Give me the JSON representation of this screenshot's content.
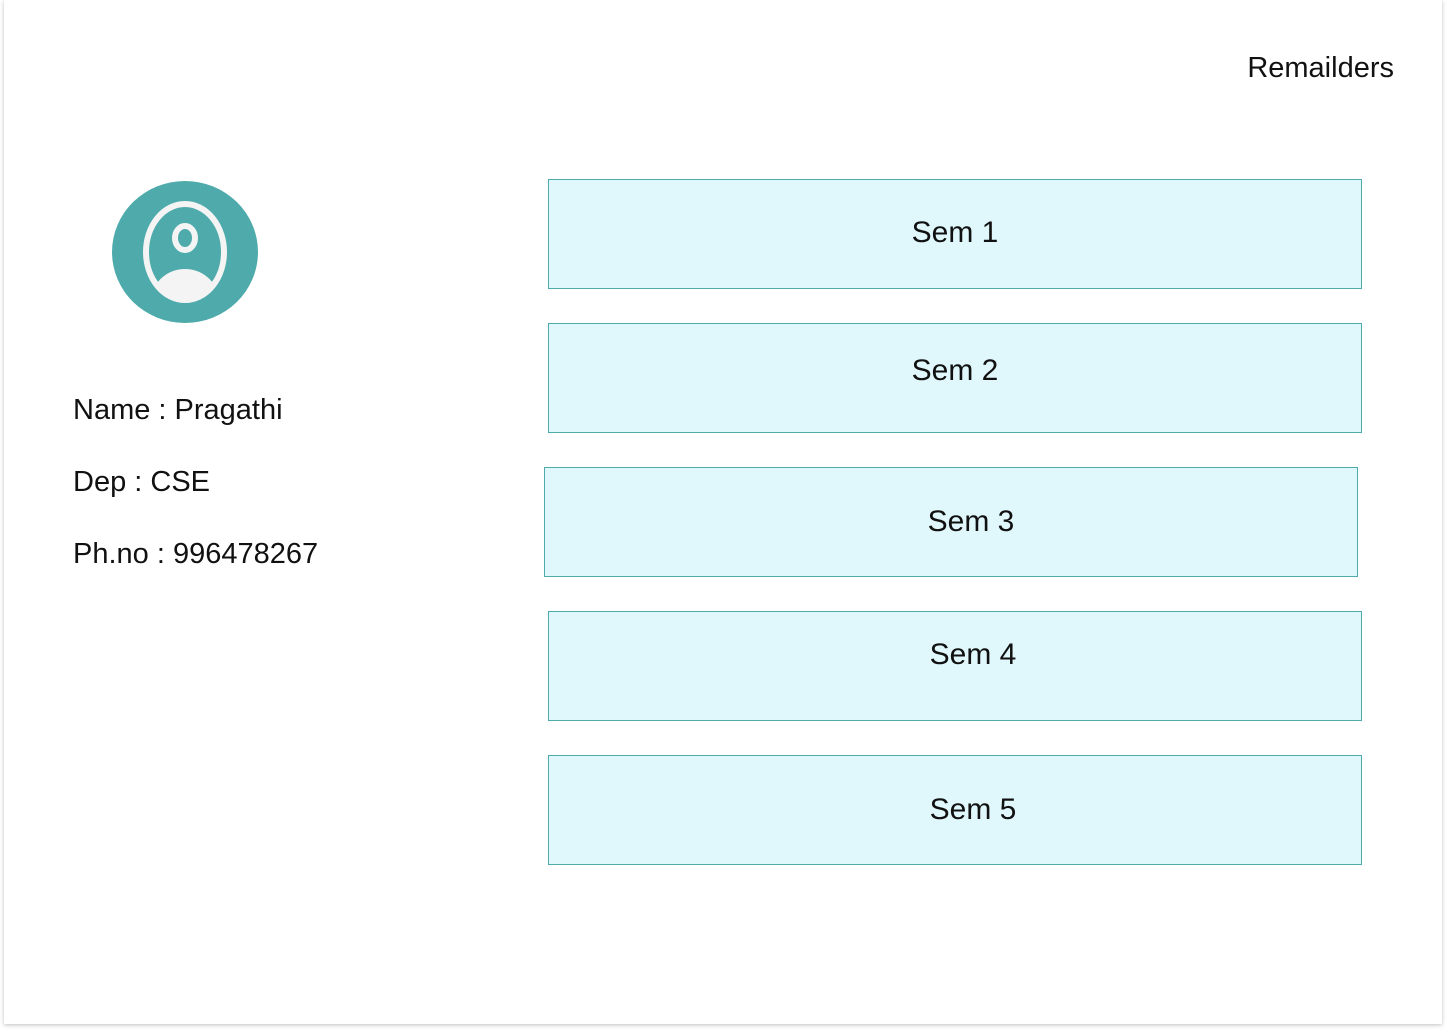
{
  "header": {
    "reminders_label": "Remailders"
  },
  "profile": {
    "avatar_icon": "user-avatar-icon",
    "name_line": "Name : Pragathi",
    "dep_line": "Dep : CSE",
    "phone_line": "Ph.no : 996478267"
  },
  "semesters": [
    {
      "label": "Sem 1"
    },
    {
      "label": "Sem 2"
    },
    {
      "label": "Sem 3"
    },
    {
      "label": "Sem 4"
    },
    {
      "label": "Sem 5"
    }
  ],
  "colors": {
    "accent": "#4fabab",
    "button_fill": "#e0f8fc",
    "text": "#111111"
  }
}
